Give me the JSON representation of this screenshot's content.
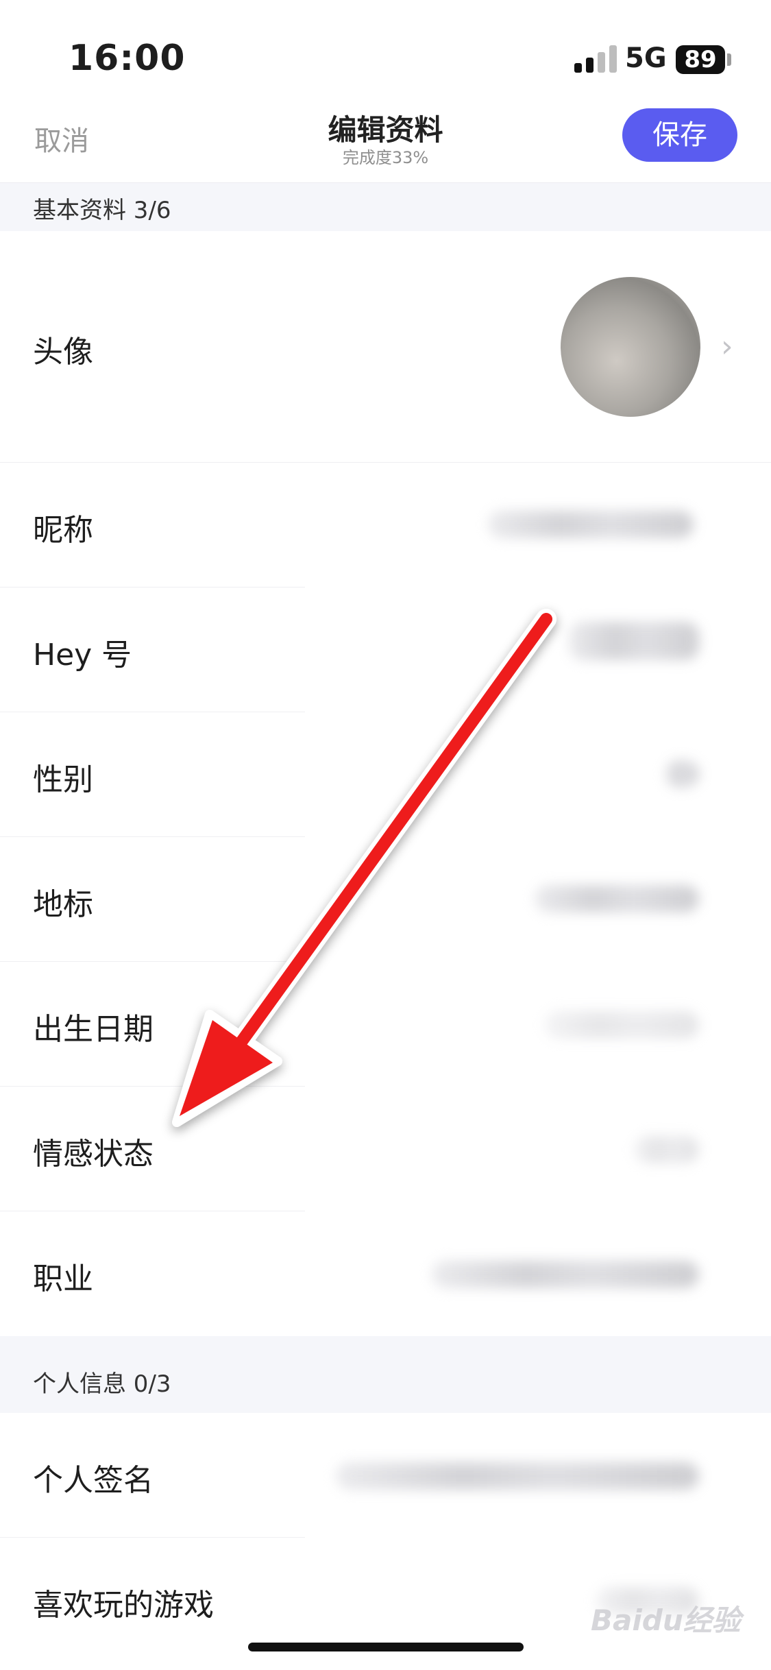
{
  "status_bar": {
    "time": "16:00",
    "network": "5G",
    "battery": "89"
  },
  "nav": {
    "cancel_label": "取消",
    "title": "编辑资料",
    "subtitle": "完成度33%",
    "save_label": "保存"
  },
  "sections": [
    {
      "header": "基本资料 3/6"
    },
    {
      "header": "个人信息 0/3"
    }
  ],
  "rows": {
    "avatar": "头像",
    "nickname": "昵称",
    "hey_id": "Hey 号",
    "gender": "性别",
    "landmark": "地标",
    "birthday": "出生日期",
    "relationship": "情感状态",
    "occupation": "职业",
    "signature": "个人签名",
    "games": "喜欢玩的游戏"
  },
  "icons": {
    "chevron": "chevron-right-icon",
    "arrow": "red-annotation-arrow"
  },
  "colors": {
    "accent": "#5a5cf0",
    "arrow": "#ee1c1c"
  },
  "watermark": "Baidu经验"
}
